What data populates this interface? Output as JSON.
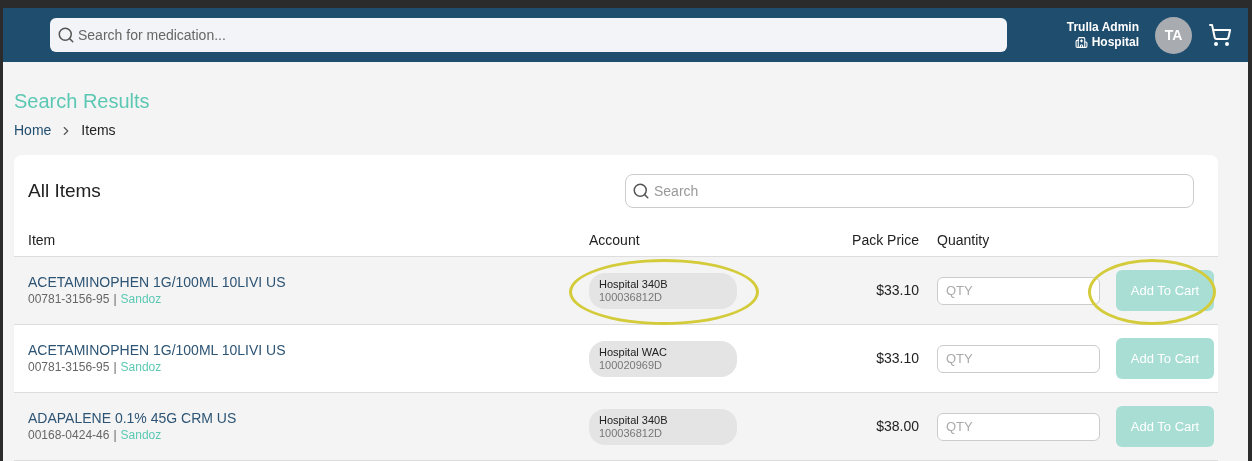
{
  "header": {
    "search": {
      "placeholder": "Search for medication..."
    },
    "user": {
      "name": "Trulla Admin",
      "org": "Hospital",
      "initials": "TA"
    }
  },
  "page": {
    "title": "Search Results",
    "breadcrumb": [
      "Home",
      "Items"
    ]
  },
  "card": {
    "title": "All Items",
    "search": {
      "placeholder": "Search"
    },
    "columns": [
      "Item",
      "Account",
      "Pack Price",
      "Quantity"
    ],
    "separator": "|",
    "rows": [
      {
        "name": "ACETAMINOPHEN 1G/100ML 10LIVI US",
        "ndc": "00781-3156-95",
        "maker": "Sandoz",
        "account": "Hospital 340B",
        "account_no": "100036812D",
        "price": "$33.10",
        "qty_placeholder": "QTY",
        "button": "Add To Cart",
        "account_circled": true,
        "button_circled": true
      },
      {
        "name": "ACETAMINOPHEN 1G/100ML 10LIVI US",
        "ndc": "00781-3156-95",
        "maker": "Sandoz",
        "account": "Hospital WAC",
        "account_no": "100020969D",
        "price": "$33.10",
        "qty_placeholder": "QTY",
        "button": "Add To Cart",
        "account_circled": false,
        "button_circled": false
      },
      {
        "name": "ADAPALENE 0.1% 45G CRM US",
        "ndc": "00168-0424-46",
        "maker": "Sandoz",
        "account": "Hospital 340B",
        "account_no": "100036812D",
        "price": "$38.00",
        "qty_placeholder": "QTY",
        "button": "Add To Cart",
        "account_circled": false,
        "button_circled": false
      }
    ]
  }
}
